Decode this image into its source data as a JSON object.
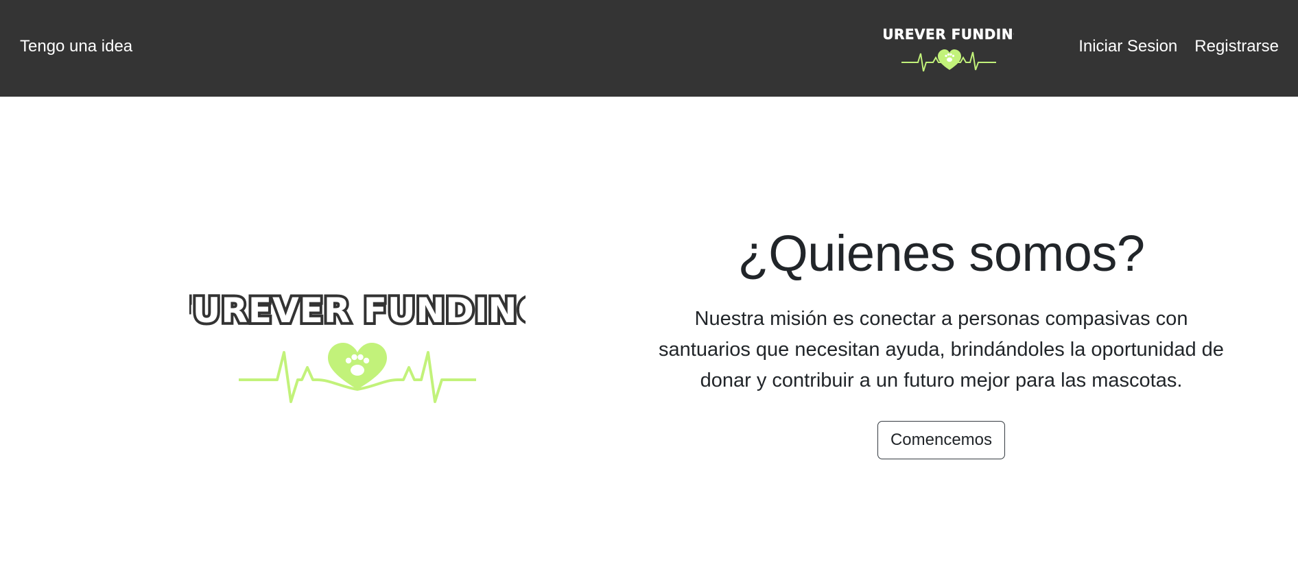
{
  "navbar": {
    "left_link": "Tengo una idea",
    "logo_text": "FUREVER FUNDING",
    "login_label": "Iniciar Sesion",
    "register_label": "Registrarse"
  },
  "hero": {
    "logo_text": "FUREVER FUNDING",
    "title": "¿Quienes somos?",
    "description": "Nuestra misión es conectar a personas compasivas con santuarios que necesitan ayuda, brindándoles la oportunidad de donar y contribuir a un futuro mejor para las mascotas.",
    "cta_label": "Comencemos"
  },
  "colors": {
    "navbar_bg": "#343434",
    "accent_green": "#c2f27a",
    "text_dark": "#212529"
  },
  "icons": [
    "heart-paw-icon",
    "heartbeat-line-icon"
  ]
}
